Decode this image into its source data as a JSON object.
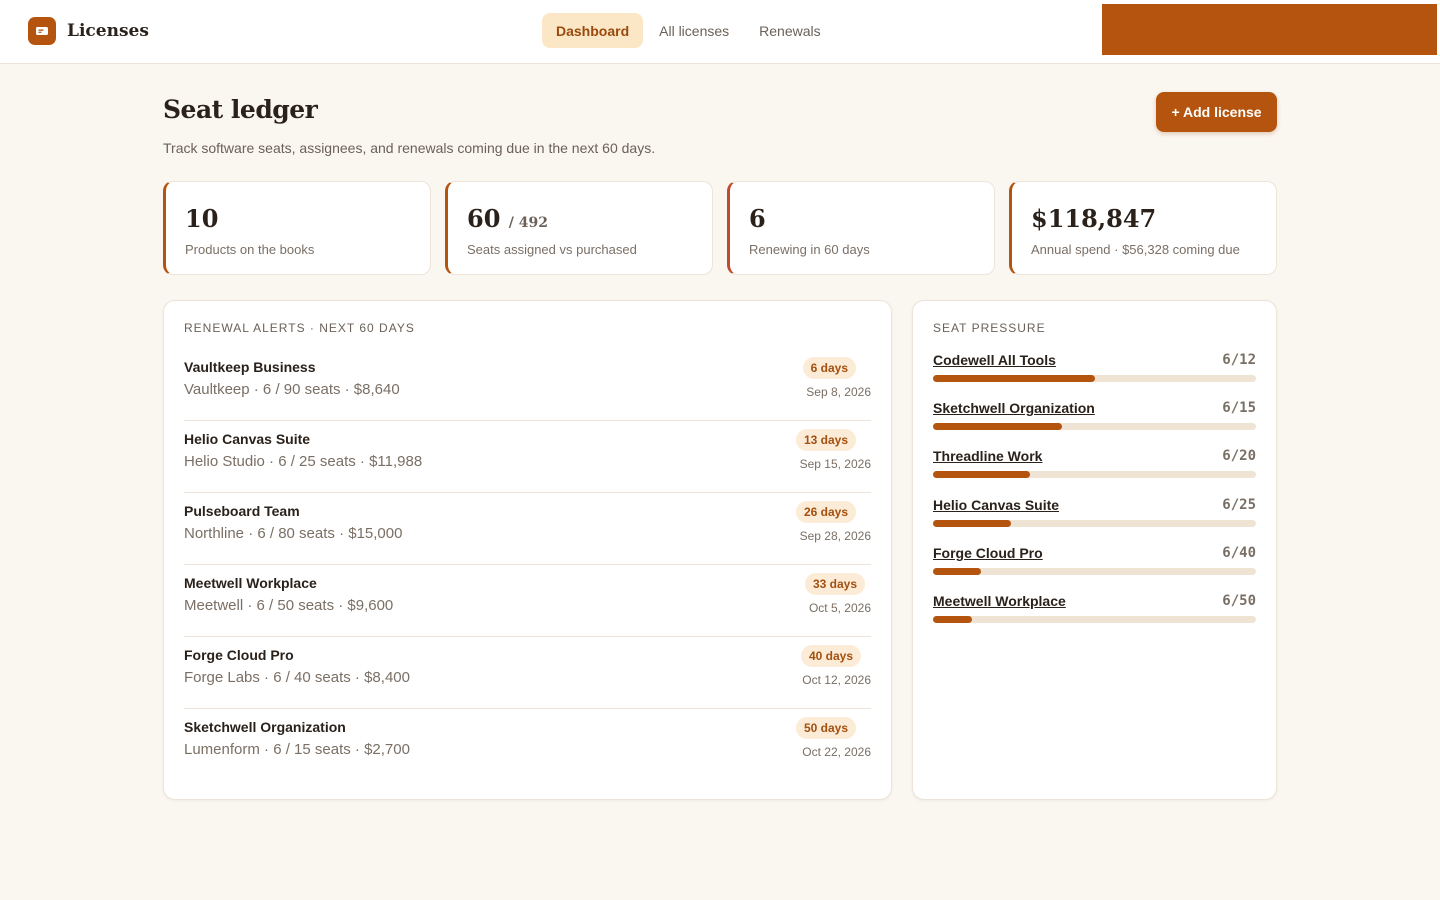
{
  "app": {
    "name": "Licenses",
    "logo_icon": "ticket-icon",
    "accent_color": "#b5540e"
  },
  "nav": {
    "items": [
      {
        "label": "Dashboard",
        "active": true
      },
      {
        "label": "All licenses",
        "active": false
      },
      {
        "label": "Renewals",
        "active": false
      }
    ]
  },
  "header": {
    "title": "Seat ledger",
    "subtitle": "Track software seats, assignees, and renewals coming due in the next 60 days.",
    "add_button_label": "+ Add license"
  },
  "stats": [
    {
      "value": "10",
      "value_suffix": "",
      "label": "Products on the books"
    },
    {
      "value": "60",
      "value_suffix": "/ 492",
      "label": "Seats assigned vs purchased"
    },
    {
      "value": "6",
      "value_suffix": "",
      "label": "Renewing in 60 days"
    },
    {
      "value": "$118,847",
      "value_suffix": "",
      "label": "Annual spend · $56,328 coming due"
    }
  ],
  "renewal_alerts": {
    "title": "RENEWAL ALERTS · NEXT 60 DAYS",
    "items": [
      {
        "name": "Vaultkeep Business",
        "meta": "Vaultkeep · 6 / 90 seats · $8,640",
        "days": "6 days",
        "date": "Sep 8, 2026"
      },
      {
        "name": "Helio Canvas Suite",
        "meta": "Helio Studio · 6 / 25 seats · $11,988",
        "days": "13 days",
        "date": "Sep 15, 2026"
      },
      {
        "name": "Pulseboard Team",
        "meta": "Northline · 6 / 80 seats · $15,000",
        "days": "26 days",
        "date": "Sep 28, 2026"
      },
      {
        "name": "Meetwell Workplace",
        "meta": "Meetwell · 6 / 50 seats · $9,600",
        "days": "33 days",
        "date": "Oct 5, 2026"
      },
      {
        "name": "Forge Cloud Pro",
        "meta": "Forge Labs · 6 / 40 seats · $8,400",
        "days": "40 days",
        "date": "Oct 12, 2026"
      },
      {
        "name": "Sketchwell Organization",
        "meta": "Lumenform · 6 / 15 seats · $2,700",
        "days": "50 days",
        "date": "Oct 22, 2026"
      }
    ]
  },
  "seat_pressure": {
    "title": "SEAT PRESSURE",
    "items": [
      {
        "name": "Codewell All Tools",
        "count": "6/12",
        "fraction": 0.5
      },
      {
        "name": "Sketchwell Organization",
        "count": "6/15",
        "fraction": 0.4
      },
      {
        "name": "Threadline Work",
        "count": "6/20",
        "fraction": 0.3
      },
      {
        "name": "Helio Canvas Suite",
        "count": "6/25",
        "fraction": 0.24
      },
      {
        "name": "Forge Cloud Pro",
        "count": "6/40",
        "fraction": 0.15
      },
      {
        "name": "Meetwell Workplace",
        "count": "6/50",
        "fraction": 0.12
      }
    ]
  }
}
